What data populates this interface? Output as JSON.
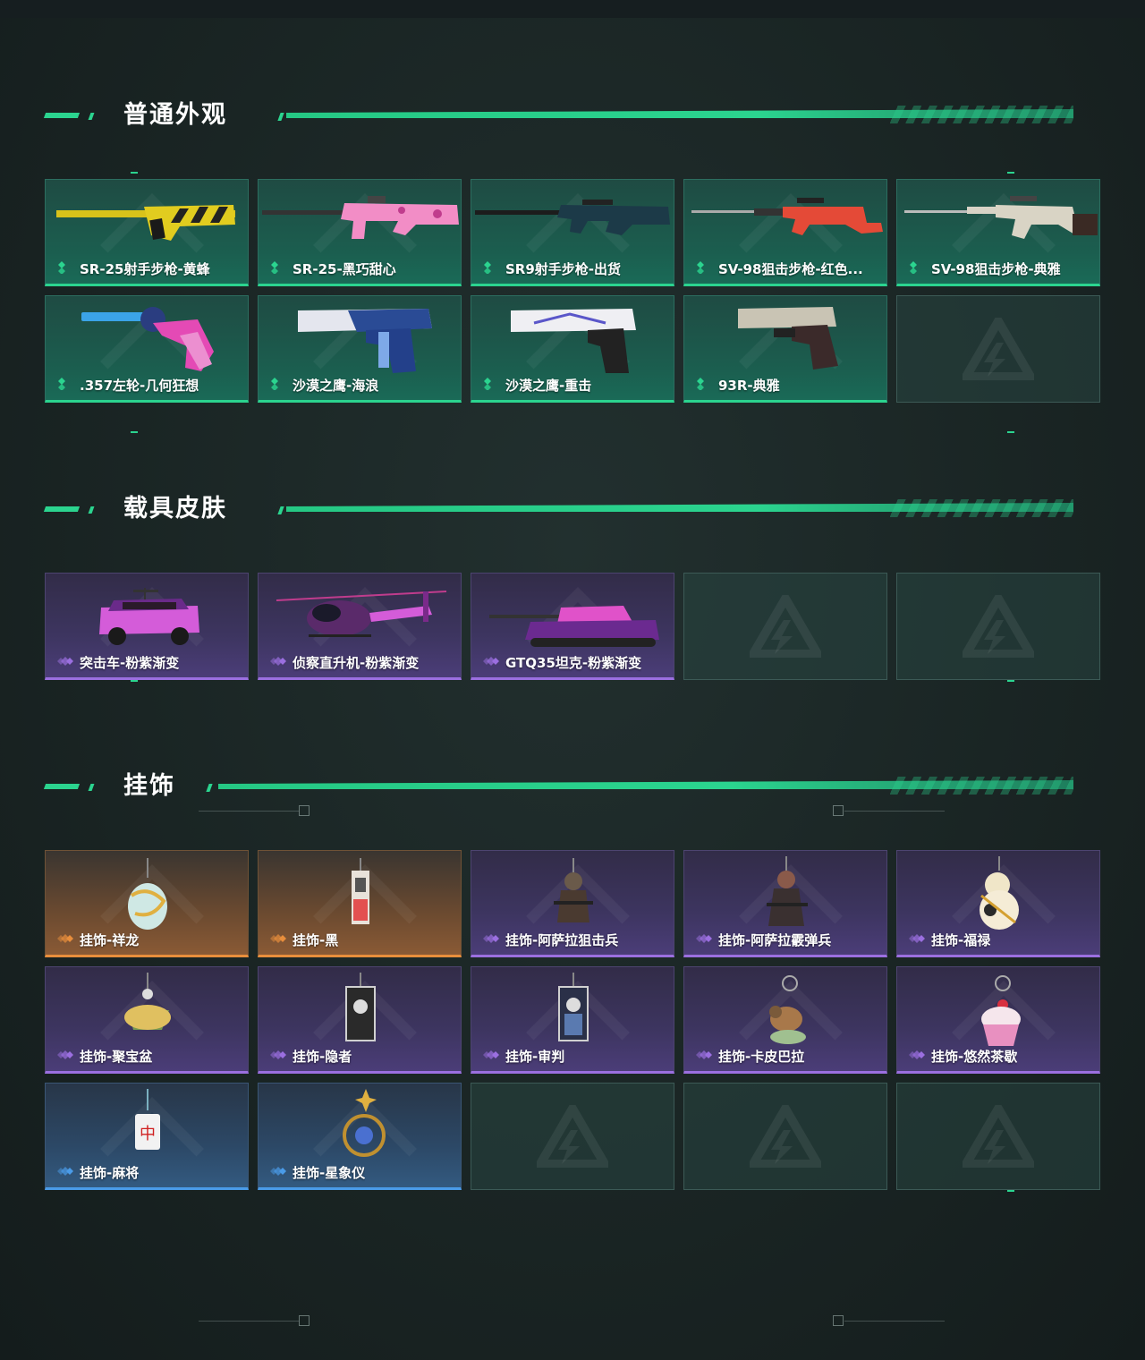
{
  "sections": [
    {
      "title": "普通外观",
      "items": [
        {
          "label": "SR-25射手步枪-黄蜂",
          "rarity": "green",
          "art": "rifle-yellow"
        },
        {
          "label": "SR-25-黑巧甜心",
          "rarity": "green",
          "art": "rifle-pink"
        },
        {
          "label": "SR9射手步枪-出货",
          "rarity": "green",
          "art": "rifle-dark"
        },
        {
          "label": "SV-98狙击步枪-红色...",
          "rarity": "green",
          "art": "sniper-red"
        },
        {
          "label": "SV-98狙击步枪-典雅",
          "rarity": "green",
          "art": "sniper-white"
        },
        {
          "label": ".357左轮-几何狂想",
          "rarity": "green",
          "art": "revolver"
        },
        {
          "label": "沙漠之鹰-海浪",
          "rarity": "green",
          "art": "deagle-blue"
        },
        {
          "label": "沙漠之鹰-重击",
          "rarity": "green",
          "art": "deagle-white"
        },
        {
          "label": "93R-典雅",
          "rarity": "green",
          "art": "pistol-93r"
        },
        {
          "label": "",
          "rarity": "empty"
        }
      ]
    },
    {
      "title": "载具皮肤",
      "items": [
        {
          "label": "突击车-粉紫渐变",
          "rarity": "purple",
          "art": "car"
        },
        {
          "label": "侦察直升机-粉紫渐变",
          "rarity": "purple",
          "art": "heli"
        },
        {
          "label": "GTQ35坦克-粉紫渐变",
          "rarity": "purple",
          "art": "tank"
        },
        {
          "label": "",
          "rarity": "empty"
        },
        {
          "label": "",
          "rarity": "empty"
        }
      ]
    },
    {
      "title": "挂饰",
      "items": [
        {
          "label": "挂饰-祥龙",
          "rarity": "orange",
          "art": "charm-dragon"
        },
        {
          "label": "挂饰-黑",
          "rarity": "orange",
          "art": "charm-card"
        },
        {
          "label": "挂饰-阿萨拉狙击兵",
          "rarity": "purple",
          "art": "charm-soldier"
        },
        {
          "label": "挂饰-阿萨拉霰弹兵",
          "rarity": "purple",
          "art": "charm-soldier2"
        },
        {
          "label": "挂饰-福禄",
          "rarity": "purple",
          "art": "charm-gourd"
        },
        {
          "label": "挂饰-聚宝盆",
          "rarity": "purple",
          "art": "charm-bowl"
        },
        {
          "label": "挂饰-隐者",
          "rarity": "purple",
          "art": "charm-tarot"
        },
        {
          "label": "挂饰-审判",
          "rarity": "purple",
          "art": "charm-tarot2"
        },
        {
          "label": "挂饰-卡皮巴拉",
          "rarity": "purple",
          "art": "charm-capybara"
        },
        {
          "label": "挂饰-悠然茶歇",
          "rarity": "purple",
          "art": "charm-cupcake"
        },
        {
          "label": "挂饰-麻将",
          "rarity": "blue",
          "art": "charm-mahjong"
        },
        {
          "label": "挂饰-星象仪",
          "rarity": "blue",
          "art": "charm-astro"
        },
        {
          "label": "",
          "rarity": "empty"
        },
        {
          "label": "",
          "rarity": "empty"
        },
        {
          "label": "",
          "rarity": "empty"
        }
      ]
    }
  ],
  "colors": {
    "accent": "#2bd48f",
    "green": "#2bd48f",
    "purple": "#9b6fe0",
    "orange": "#e88e3c",
    "blue": "#4a9be8"
  }
}
